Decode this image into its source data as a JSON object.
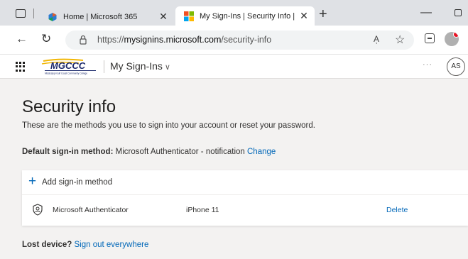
{
  "browser": {
    "tabs": [
      {
        "title": "Home | Microsoft 365",
        "active": false,
        "icon": "m365-icon"
      },
      {
        "title": "My Sign-Ins | Security Info | Micr",
        "active": true,
        "icon": "microsoft-logo-icon"
      }
    ],
    "close_glyph": "✕",
    "new_tab_glyph": "+",
    "minimize_glyph": "—",
    "back_glyph": "←",
    "refresh_glyph": "↻",
    "url_prefix": "https://",
    "url_host": "mysignins.microsoft.com",
    "url_path": "/security-info",
    "read_aloud_glyph": "Aͅ",
    "favorites_glyph": "☆"
  },
  "app": {
    "logo_text": "MGCCC",
    "logo_caption": "Mississippi Gulf Coast Community College",
    "name": "My Sign-Ins",
    "name_chevron": "∨",
    "more_glyph": "···",
    "user_initials": "AS"
  },
  "page": {
    "title": "Security info",
    "subtitle": "These are the methods you use to sign into your account or reset your password.",
    "default_method_label": "Default sign-in method:",
    "default_method_value": "Microsoft Authenticator - notification",
    "change_link": "Change",
    "add_method_label": "Add sign-in method",
    "add_glyph": "+",
    "methods": [
      {
        "name": "Microsoft Authenticator",
        "device": "iPhone 11",
        "action": "Delete",
        "icon": "authenticator-icon"
      }
    ],
    "lost_device_label": "Lost device?",
    "sign_out_link": "Sign out everywhere"
  },
  "colors": {
    "link": "#0067b8",
    "page_bg": "#f3f2f1",
    "tabstrip_bg": "#dfe1e5",
    "logo_gold": "#f2b705",
    "logo_navy": "#1c2a6b"
  }
}
